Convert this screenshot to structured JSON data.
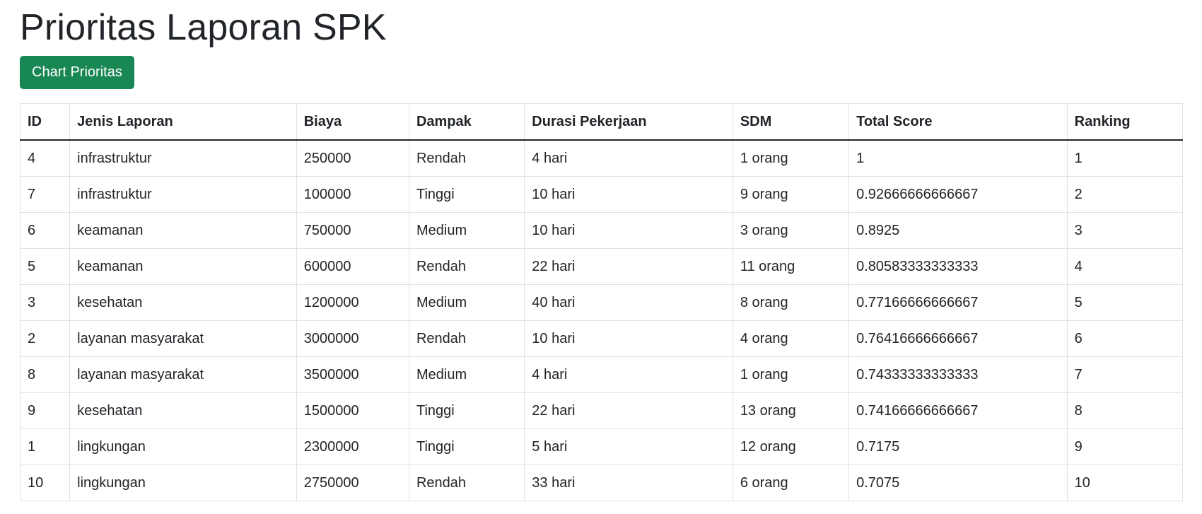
{
  "page": {
    "title": "Prioritas Laporan SPK",
    "chart_button_label": "Chart Prioritas"
  },
  "colors": {
    "button_bg": "#198754",
    "header_border": "#212529",
    "cell_border": "#dee2e6"
  },
  "table": {
    "headers": [
      "ID",
      "Jenis Laporan",
      "Biaya",
      "Dampak",
      "Durasi Pekerjaan",
      "SDM",
      "Total Score",
      "Ranking"
    ],
    "rows": [
      [
        "4",
        "infrastruktur",
        "250000",
        "Rendah",
        "4 hari",
        "1 orang",
        "1",
        "1"
      ],
      [
        "7",
        "infrastruktur",
        "100000",
        "Tinggi",
        "10 hari",
        "9 orang",
        "0.92666666666667",
        "2"
      ],
      [
        "6",
        "keamanan",
        "750000",
        "Medium",
        "10 hari",
        "3 orang",
        "0.8925",
        "3"
      ],
      [
        "5",
        "keamanan",
        "600000",
        "Rendah",
        "22 hari",
        "11 orang",
        "0.80583333333333",
        "4"
      ],
      [
        "3",
        "kesehatan",
        "1200000",
        "Medium",
        "40 hari",
        "8 orang",
        "0.77166666666667",
        "5"
      ],
      [
        "2",
        "layanan masyarakat",
        "3000000",
        "Rendah",
        "10 hari",
        "4 orang",
        "0.76416666666667",
        "6"
      ],
      [
        "8",
        "layanan masyarakat",
        "3500000",
        "Medium",
        "4 hari",
        "1 orang",
        "0.74333333333333",
        "7"
      ],
      [
        "9",
        "kesehatan",
        "1500000",
        "Tinggi",
        "22 hari",
        "13 orang",
        "0.74166666666667",
        "8"
      ],
      [
        "1",
        "lingkungan",
        "2300000",
        "Tinggi",
        "5 hari",
        "12 orang",
        "0.7175",
        "9"
      ],
      [
        "10",
        "lingkungan",
        "2750000",
        "Rendah",
        "33 hari",
        "6 orang",
        "0.7075",
        "10"
      ]
    ]
  }
}
